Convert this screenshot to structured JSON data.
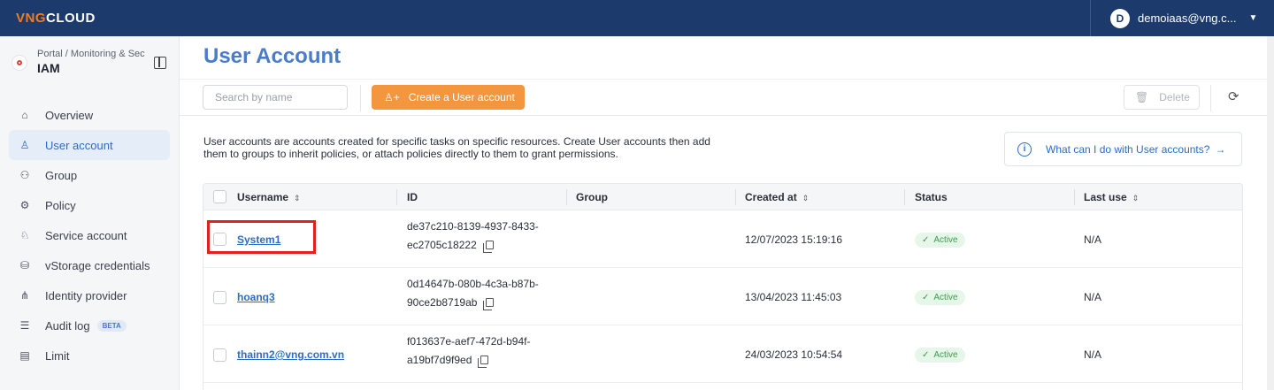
{
  "topbar": {
    "logo_prefix": "VNG",
    "logo_suffix": "CLOUD",
    "avatar_letter": "D",
    "user": "demoiaas@vng.c..."
  },
  "sidebar": {
    "breadcrumb": "Portal  /  Monitoring & Sec",
    "title": "IAM",
    "items": [
      {
        "label": "Overview",
        "icon": "home-icon"
      },
      {
        "label": "User account",
        "icon": "user-icon",
        "active": true
      },
      {
        "label": "Group",
        "icon": "group-icon"
      },
      {
        "label": "Policy",
        "icon": "policy-icon"
      },
      {
        "label": "Service account",
        "icon": "service-account-icon"
      },
      {
        "label": "vStorage credentials",
        "icon": "storage-icon"
      },
      {
        "label": "Identity provider",
        "icon": "identity-provider-icon"
      },
      {
        "label": "Audit log",
        "icon": "audit-log-icon",
        "badge": "BETA"
      },
      {
        "label": "Limit",
        "icon": "limit-icon"
      }
    ]
  },
  "main": {
    "title": "User Account",
    "search_placeholder": "Search by name",
    "create_label": "Create a User account",
    "delete_label": "Delete",
    "description": "User accounts are accounts created for specific tasks on specific resources. Create User accounts then add them to groups to inherit policies, or attach policies directly to them to grant permissions.",
    "help_label": "What can I do with User accounts?",
    "help_arrow": "→"
  },
  "table": {
    "columns": [
      "Username",
      "ID",
      "Group",
      "Created at",
      "Status",
      "Last use"
    ],
    "rows": [
      {
        "username": "System1",
        "id_1": "de37c210-8139-4937-8433-",
        "id_2": "ec2705c18222",
        "group": "",
        "created": "12/07/2023 15:19:16",
        "status": "Active",
        "last_use": "N/A"
      },
      {
        "username": "hoanq3",
        "id_1": "0d14647b-080b-4c3a-b87b-",
        "id_2": "90ce2b8719ab",
        "group": "",
        "created": "13/04/2023 11:45:03",
        "status": "Active",
        "last_use": "N/A"
      },
      {
        "username": "thainn2@vng.com.vn",
        "id_1": "f013637e-aef7-472d-b94f-",
        "id_2": "a19bf7d9f9ed",
        "group": "",
        "created": "24/03/2023 10:54:54",
        "status": "Active",
        "last_use": "N/A"
      }
    ]
  },
  "colors": {
    "accent": "#2b6cc4",
    "primary_button": "#f3963e",
    "topbar": "#1c3a6b",
    "highlight": "#e32020"
  }
}
